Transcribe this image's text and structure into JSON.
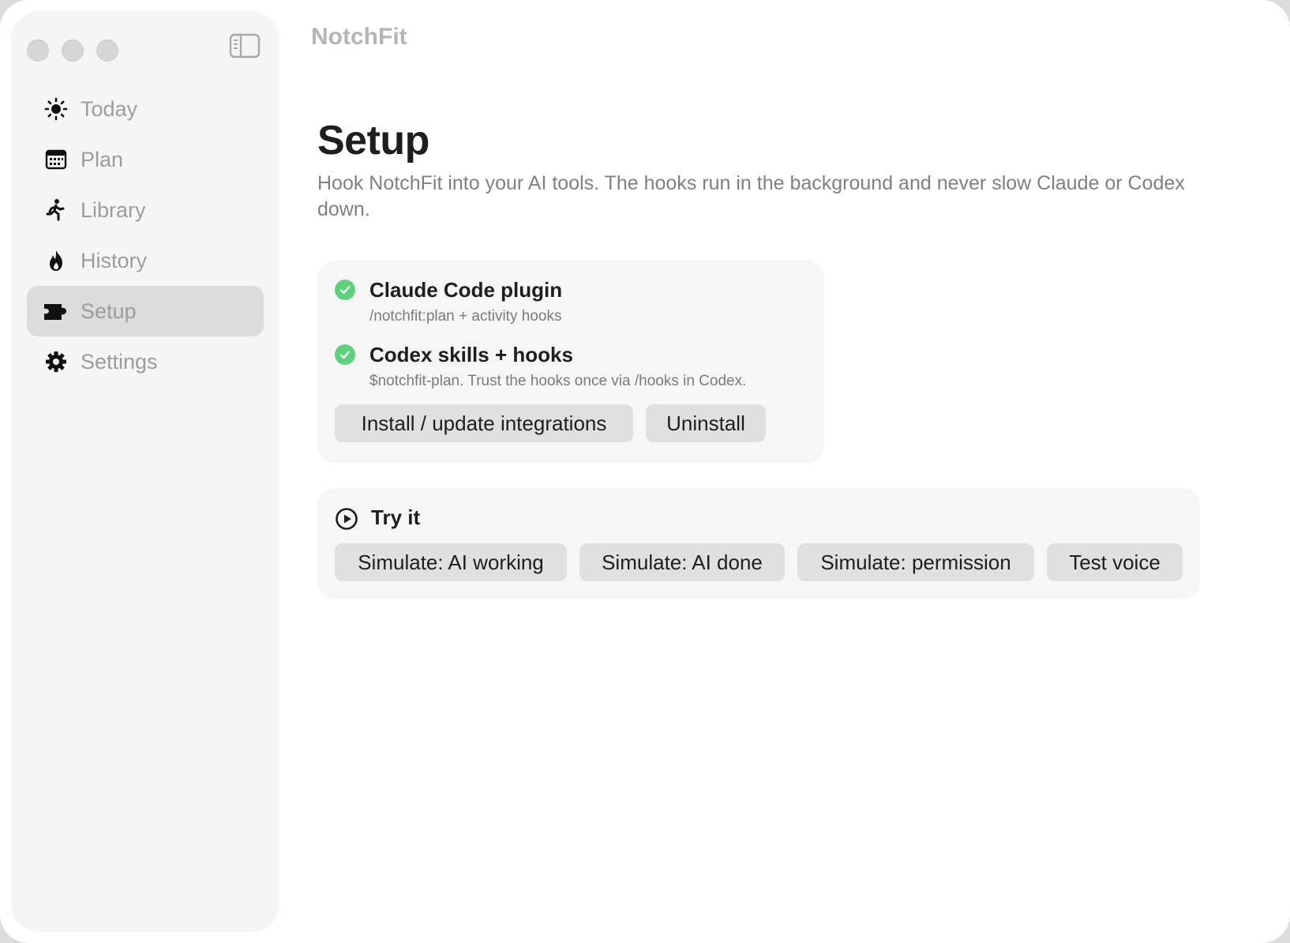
{
  "app": {
    "title": "NotchFit"
  },
  "window_controls": {
    "close": "close-button",
    "minimize": "minimize-button",
    "zoom": "zoom-button"
  },
  "sidebar": {
    "toggle_icon": "sidebar-toggle-icon",
    "items": [
      {
        "label": "Today",
        "icon": "sun-icon",
        "active": false
      },
      {
        "label": "Plan",
        "icon": "calendar-icon",
        "active": false
      },
      {
        "label": "Library",
        "icon": "figure-run-icon",
        "active": false
      },
      {
        "label": "History",
        "icon": "flame-icon",
        "active": false
      },
      {
        "label": "Setup",
        "icon": "puzzle-icon",
        "active": true
      },
      {
        "label": "Settings",
        "icon": "gear-icon",
        "active": false
      }
    ]
  },
  "page": {
    "title": "Setup",
    "subtitle": "Hook NotchFit into your AI tools. The hooks run in the background and never slow Claude or Codex down."
  },
  "integrations": {
    "items": [
      {
        "title": "Claude Code plugin",
        "description": "/notchfit:plan + activity hooks",
        "status": "installed"
      },
      {
        "title": "Codex skills + hooks",
        "description": "$notchfit-plan. Trust the hooks once via /hooks in Codex.",
        "status": "installed"
      }
    ],
    "install_label": "Install / update integrations",
    "uninstall_label": "Uninstall"
  },
  "try_it": {
    "title": "Try it",
    "buttons": [
      "Simulate: AI working",
      "Simulate: AI done",
      "Simulate: permission",
      "Test voice"
    ]
  },
  "colors": {
    "check_green": "#5fd17a",
    "sidebar_bg": "#f5f5f5",
    "active_item_bg": "#dcdcdc",
    "card_bg": "#f6f6f6",
    "button_bg": "#e0e0e0"
  }
}
